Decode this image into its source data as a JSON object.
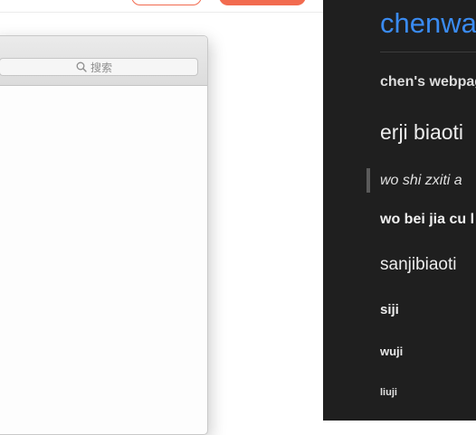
{
  "search": {
    "placeholder": "搜索",
    "icon": "search-icon"
  },
  "colors": {
    "accent_orange": "#f26b4f",
    "sidebar_bg": "#1f1f1f",
    "title_blue": "#3a8bf1"
  },
  "sidebar": {
    "site_title": "chenwa",
    "subtitle": "chen's webpag",
    "h2": "erji biaoti",
    "quote": "wo shi zxiti a",
    "bold_text": "wo bei jia cu l",
    "h3": "sanjibiaoti",
    "h4": "siji",
    "h5": "wuji",
    "h6": "liuji"
  }
}
